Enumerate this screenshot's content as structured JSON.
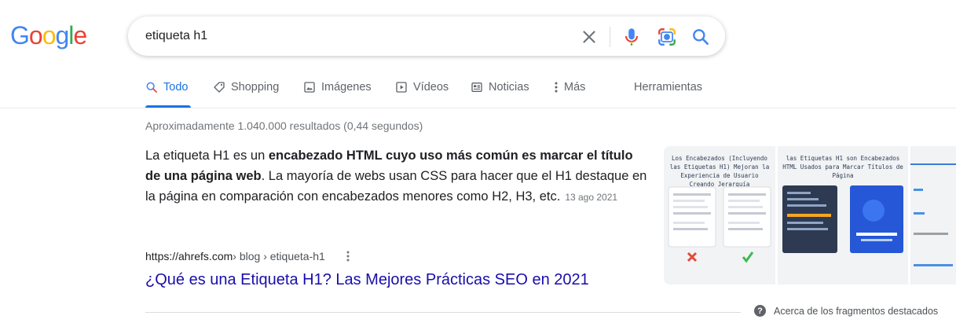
{
  "logo": {
    "letters": [
      "G",
      "o",
      "o",
      "g",
      "l",
      "e"
    ],
    "colors": [
      "#4285f4",
      "#ea4335",
      "#fbbc05",
      "#4285f4",
      "#34a853",
      "#ea4335"
    ]
  },
  "search": {
    "value": "etiqueta h1"
  },
  "tabs": [
    {
      "label": "Todo",
      "icon": "search-icon"
    },
    {
      "label": "Shopping",
      "icon": "tag-icon"
    },
    {
      "label": "Imágenes",
      "icon": "image-icon"
    },
    {
      "label": "Vídeos",
      "icon": "play-icon"
    },
    {
      "label": "Noticias",
      "icon": "news-icon"
    },
    {
      "label": "Más",
      "icon": "more-vert-icon"
    }
  ],
  "tools_label": "Herramientas",
  "stats": "Aproximadamente 1.040.000 resultados (0,44 segundos)",
  "snippet": {
    "part1": "La etiqueta H1 es un ",
    "bold": "encabezado HTML cuyo uso más común es marcar el título de una página web",
    "part2": ". La mayoría de webs usan CSS para hacer que el H1 destaque en la página en comparación con encabezados menores como H2, H3, etc.",
    "date": "13 ago 2021"
  },
  "result": {
    "site": "https://ahrefs.com",
    "path": " › blog › etiqueta-h1",
    "title": "¿Qué es una Etiqueta H1? Las Mejores Prácticas SEO en 2021"
  },
  "thumbnails": [
    {
      "caption": "Los Encabezados (Incluyendo las Etiquetas H1) Mejoran la Experiencia de Usuario Creando Jerarquía"
    },
    {
      "caption": "las Etiquetas H1 son Encabezados HTML Usados para Marcar Títulos de Página"
    },
    {
      "caption": ""
    }
  ],
  "about_label": "Acerca de los fragmentos destacados",
  "colors": {
    "accent": "#1a73e8",
    "link": "#1a0dab",
    "muted": "#70757a"
  }
}
